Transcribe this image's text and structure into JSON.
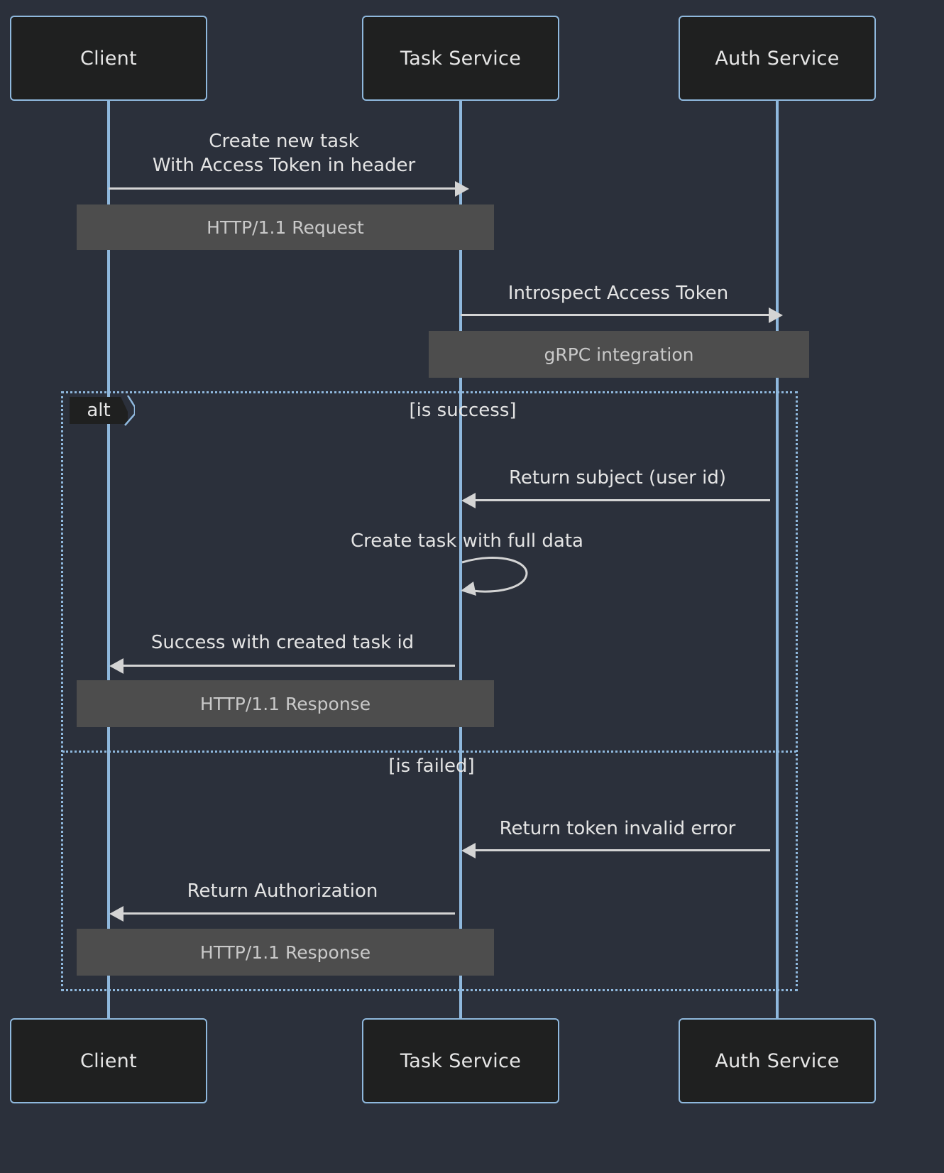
{
  "diagram": {
    "type": "sequence-diagram",
    "background_color": "#2b303b",
    "participant_fill": "#1f2020",
    "participant_border": "#8fb8dd",
    "lifeline_color": "#8fb8dd",
    "note_fill": "#4d4d4d",
    "note_text_color": "#c9c9c9",
    "arrow_color": "#d4d4d4",
    "text_color": "#e4e4e4"
  },
  "participants": [
    {
      "id": "client",
      "label": "Client"
    },
    {
      "id": "task",
      "label": "Task Service"
    },
    {
      "id": "auth",
      "label": "Auth Service"
    }
  ],
  "participants_bottom": [
    {
      "id": "client",
      "label": "Client"
    },
    {
      "id": "task",
      "label": "Task Service"
    },
    {
      "id": "auth",
      "label": "Auth Service"
    }
  ],
  "messages": [
    {
      "id": "m1",
      "from": "client",
      "to": "task",
      "line1": "Create new task",
      "line2": "With Access Token in header",
      "direction": "right"
    },
    {
      "id": "m2",
      "from": "task",
      "to": "auth",
      "line1": "Introspect Access Token",
      "direction": "right"
    },
    {
      "id": "m3",
      "from": "auth",
      "to": "task",
      "line1": "Return subject (user id)",
      "direction": "left"
    },
    {
      "id": "m4",
      "from": "task",
      "to": "task",
      "line1": "Create task with full data",
      "direction": "self"
    },
    {
      "id": "m5",
      "from": "task",
      "to": "client",
      "line1": "Success with created task id",
      "direction": "left"
    },
    {
      "id": "m6",
      "from": "auth",
      "to": "task",
      "line1": "Return token invalid error",
      "direction": "left"
    },
    {
      "id": "m7",
      "from": "task",
      "to": "client",
      "line1": "Return Authorization",
      "direction": "left"
    }
  ],
  "notes": [
    {
      "id": "n1",
      "label": "HTTP/1.1 Request"
    },
    {
      "id": "n2",
      "label": "gRPC integration"
    },
    {
      "id": "n3",
      "label": "HTTP/1.1 Response"
    },
    {
      "id": "n4",
      "label": "HTTP/1.1 Response"
    }
  ],
  "fragment": {
    "kind": "alt",
    "tag": "alt",
    "branches": [
      {
        "id": "b1",
        "condition": "[is success]"
      },
      {
        "id": "b2",
        "condition": "[is failed]"
      }
    ]
  }
}
